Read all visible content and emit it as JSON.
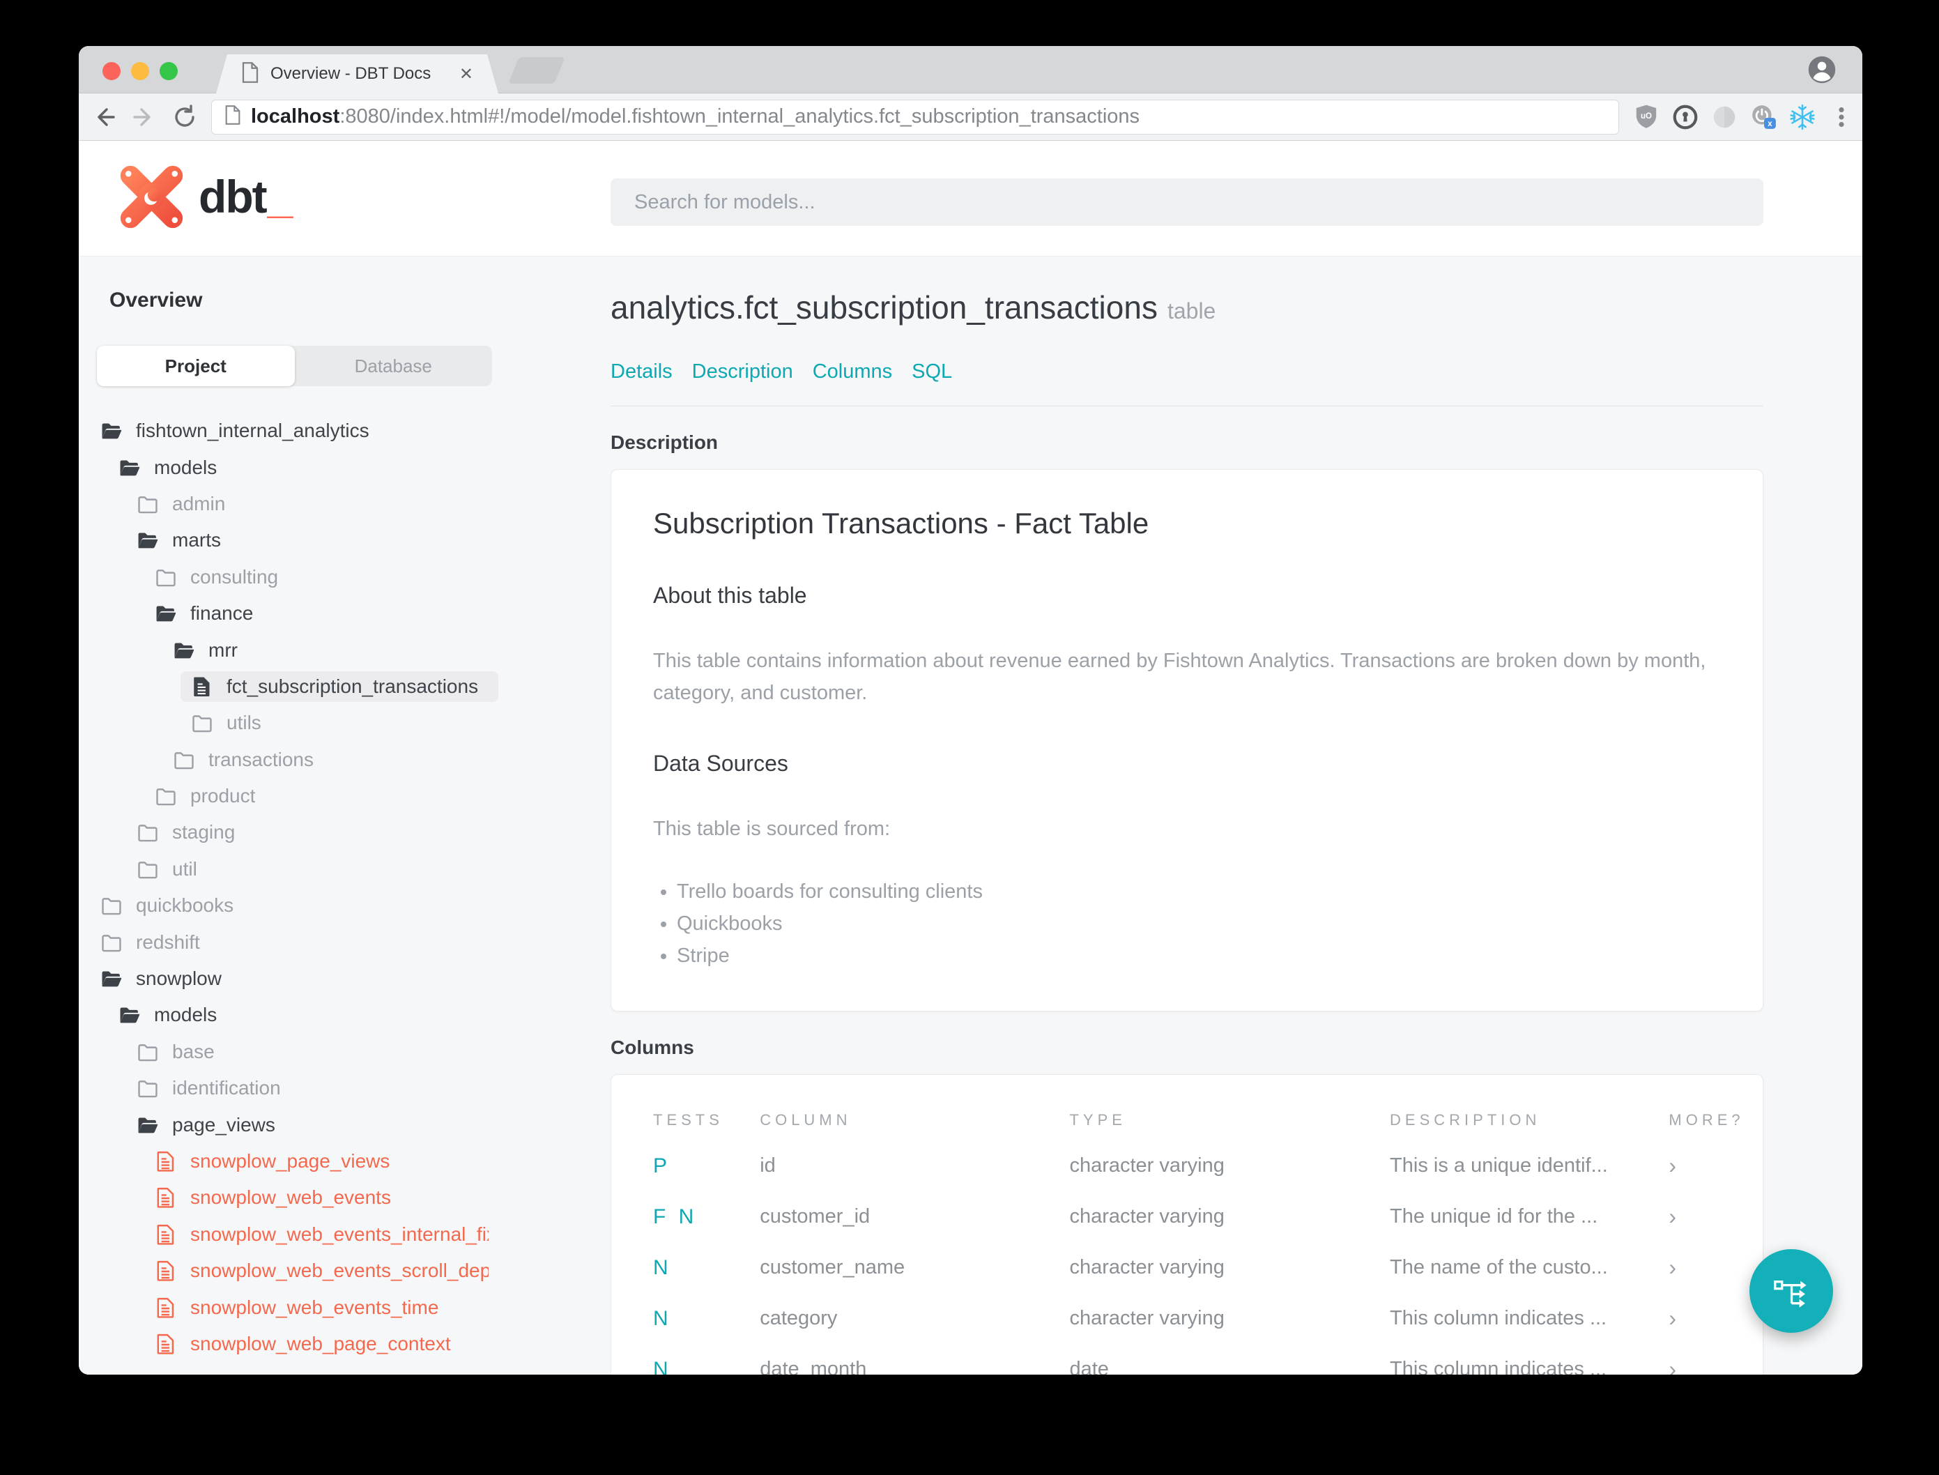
{
  "browser": {
    "tab_title": "Overview - DBT Docs",
    "url": {
      "host": "localhost",
      "rest": ":8080/index.html#!/model/model.fishtown_internal_analytics.fct_subscription_transactions"
    },
    "toolbar_icons": [
      "back-arrow",
      "forward-arrow",
      "refresh"
    ],
    "extension_icons": [
      "ublock-shield",
      "1password-keyhole",
      "gray-circle",
      "power-x-badge",
      "snowflake",
      "kebab-menu"
    ],
    "window_buttons": [
      "close",
      "minimize",
      "zoom"
    ]
  },
  "header": {
    "logo_text": "dbt",
    "logo_cursor": "_",
    "search_placeholder": "Search for models..."
  },
  "sidebar": {
    "title": "Overview",
    "tabs": [
      {
        "label": "Project",
        "active": true
      },
      {
        "label": "Database",
        "active": false
      }
    ],
    "tree": [
      {
        "label": "fishtown_internal_analytics",
        "level": 0,
        "kind": "folder-open"
      },
      {
        "label": "models",
        "level": 1,
        "kind": "folder-open"
      },
      {
        "label": "admin",
        "level": 2,
        "kind": "folder"
      },
      {
        "label": "marts",
        "level": 2,
        "kind": "folder-open"
      },
      {
        "label": "consulting",
        "level": 3,
        "kind": "folder"
      },
      {
        "label": "finance",
        "level": 3,
        "kind": "folder-open"
      },
      {
        "label": "mrr",
        "level": 4,
        "kind": "folder-open"
      },
      {
        "label": "fct_subscription_transactions",
        "level": 5,
        "kind": "file-dark",
        "selected": true
      },
      {
        "label": "utils",
        "level": 5,
        "kind": "folder"
      },
      {
        "label": "transactions",
        "level": 4,
        "kind": "folder"
      },
      {
        "label": "product",
        "level": 3,
        "kind": "folder"
      },
      {
        "label": "staging",
        "level": 2,
        "kind": "folder"
      },
      {
        "label": "util",
        "level": 2,
        "kind": "folder"
      },
      {
        "label": "quickbooks",
        "level": 0,
        "kind": "folder"
      },
      {
        "label": "redshift",
        "level": 0,
        "kind": "folder"
      },
      {
        "label": "snowplow",
        "level": 0,
        "kind": "folder-open"
      },
      {
        "label": "models",
        "level": 1,
        "kind": "folder-open"
      },
      {
        "label": "base",
        "level": 2,
        "kind": "folder"
      },
      {
        "label": "identification",
        "level": 2,
        "kind": "folder"
      },
      {
        "label": "page_views",
        "level": 2,
        "kind": "folder-open"
      },
      {
        "label": "snowplow_page_views",
        "level": 3,
        "kind": "file-red"
      },
      {
        "label": "snowplow_web_events",
        "level": 3,
        "kind": "file-red"
      },
      {
        "label": "snowplow_web_events_internal_fixed",
        "level": 3,
        "kind": "file-red"
      },
      {
        "label": "snowplow_web_events_scroll_depth",
        "level": 3,
        "kind": "file-red"
      },
      {
        "label": "snowplow_web_events_time",
        "level": 3,
        "kind": "file-red"
      },
      {
        "label": "snowplow_web_page_context",
        "level": 3,
        "kind": "file-red"
      }
    ]
  },
  "main": {
    "title": "analytics.fct_subscription_transactions",
    "title_suffix": "table",
    "nav_links": [
      "Details",
      "Description",
      "Columns",
      "SQL"
    ],
    "description_label": "Description",
    "columns_label": "Columns",
    "description_card": {
      "heading": "Subscription Transactions - Fact Table",
      "about_heading": "About this table",
      "about_text": "This table contains information about revenue earned by Fishtown Analytics. Transactions are broken down by month, category, and customer.",
      "sources_heading": "Data Sources",
      "sources_intro": "This table is sourced from:",
      "sources": [
        "Trello boards for consulting clients",
        "Quickbooks",
        "Stripe"
      ]
    },
    "columns_table": {
      "headers": [
        "TESTS",
        "COLUMN",
        "TYPE",
        "DESCRIPTION",
        "MORE?"
      ],
      "rows": [
        {
          "tests": "P",
          "column": "id",
          "type": "character varying",
          "description": "This is a unique identif..."
        },
        {
          "tests": "F N",
          "column": "customer_id",
          "type": "character varying",
          "description": "The unique id for the ..."
        },
        {
          "tests": "N",
          "column": "customer_name",
          "type": "character varying",
          "description": "The name of the custo..."
        },
        {
          "tests": "N",
          "column": "category",
          "type": "character varying",
          "description": "This column indicates ..."
        },
        {
          "tests": "N",
          "column": "date_month",
          "type": "date",
          "description": "This column indicates ..."
        }
      ]
    }
  },
  "fab": {
    "icon": "lineage-graph"
  },
  "colors": {
    "accent_teal": "#0ea8b2",
    "fab_teal": "#13b0ba",
    "model_red": "#f4694e",
    "logo_orange": "#ff6a50"
  }
}
